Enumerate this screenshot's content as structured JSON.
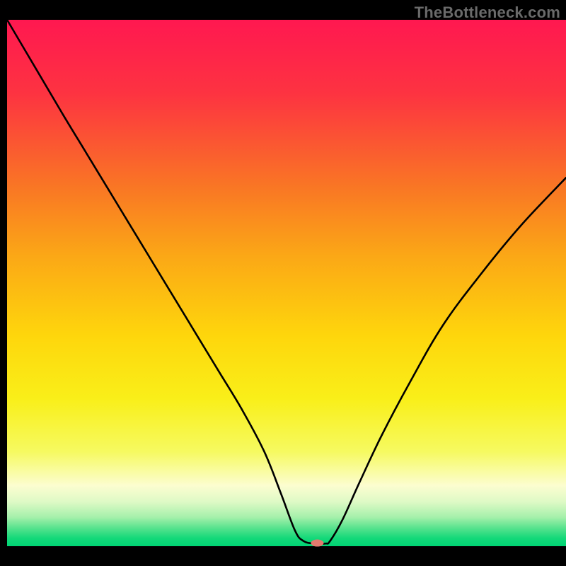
{
  "watermark": "TheBottleneck.com",
  "chart_data": {
    "type": "line",
    "title": "",
    "xlabel": "",
    "ylabel": "",
    "xlim": [
      0,
      100
    ],
    "ylim": [
      0,
      100
    ],
    "grid": false,
    "legend": false,
    "background_gradient": {
      "stops": [
        {
          "offset": 0.0,
          "color": "#ff1850"
        },
        {
          "offset": 0.14,
          "color": "#fd3341"
        },
        {
          "offset": 0.32,
          "color": "#f97724"
        },
        {
          "offset": 0.45,
          "color": "#fba816"
        },
        {
          "offset": 0.6,
          "color": "#fed60c"
        },
        {
          "offset": 0.72,
          "color": "#f9ef19"
        },
        {
          "offset": 0.82,
          "color": "#f6fa60"
        },
        {
          "offset": 0.885,
          "color": "#fcfdd0"
        },
        {
          "offset": 0.915,
          "color": "#dffac6"
        },
        {
          "offset": 0.945,
          "color": "#a5f0ab"
        },
        {
          "offset": 0.965,
          "color": "#59e38e"
        },
        {
          "offset": 0.985,
          "color": "#13d879"
        },
        {
          "offset": 1.0,
          "color": "#00d474"
        }
      ]
    },
    "series": [
      {
        "name": "bottleneck-curve",
        "color": "#000000",
        "x": [
          0,
          5,
          10,
          14,
          18,
          22,
          26,
          30,
          34,
          38,
          42,
          46,
          49,
          51.5,
          53,
          55,
          57,
          57.8,
          60,
          63,
          67,
          72,
          78,
          85,
          92,
          100
        ],
        "y": [
          100,
          91,
          82,
          75,
          68,
          61,
          54,
          47,
          40,
          33,
          26,
          18,
          10,
          3,
          1,
          0.5,
          0.5,
          1,
          5,
          12,
          21,
          31,
          42,
          52,
          61,
          70
        ]
      }
    ],
    "marker": {
      "name": "optimal-point",
      "x": 55.5,
      "y": 0.6,
      "color": "#e47a6f",
      "rx": 9,
      "ry": 5
    }
  }
}
